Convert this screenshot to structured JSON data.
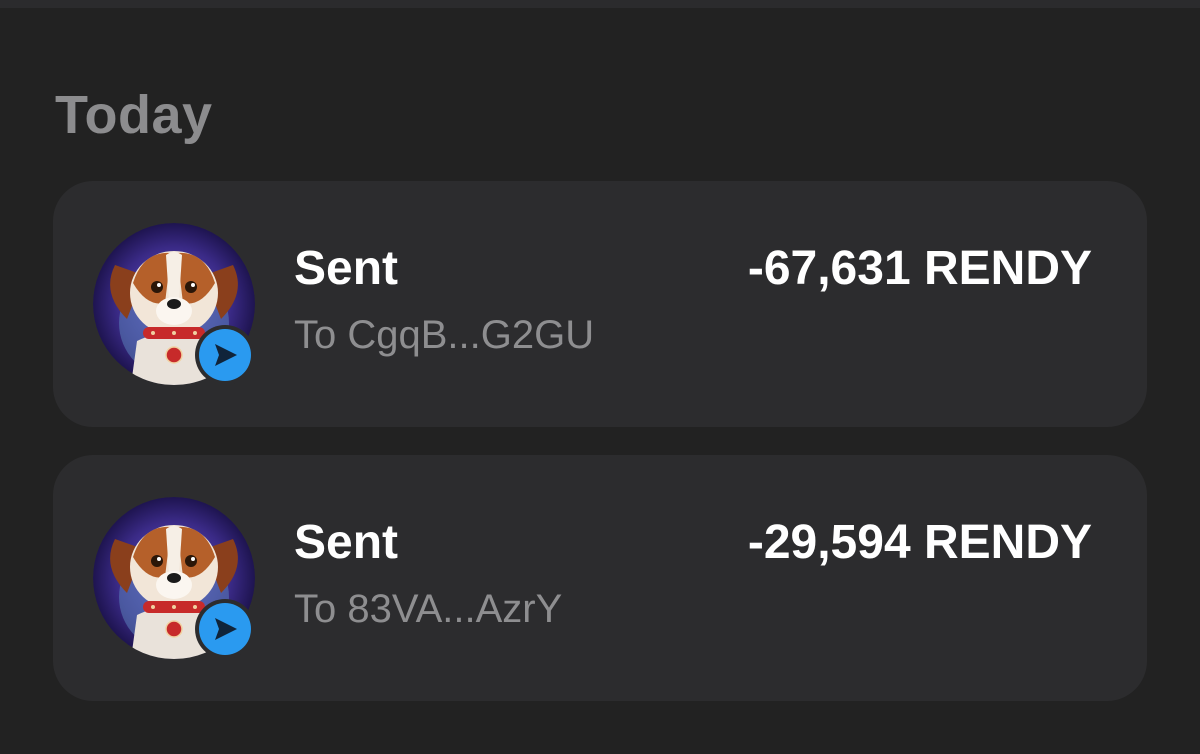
{
  "section": {
    "title": "Today"
  },
  "transactions": [
    {
      "type": "Sent",
      "destination": "To CgqB...G2GU",
      "amount": "-67,631 RENDY",
      "token_icon": "dog-avatar-icon",
      "status_icon": "send-arrow-icon"
    },
    {
      "type": "Sent",
      "destination": "To 83VA...AzrY",
      "amount": "-29,594 RENDY",
      "token_icon": "dog-avatar-icon",
      "status_icon": "send-arrow-icon"
    }
  ],
  "colors": {
    "background": "#222222",
    "card": "#2c2c2e",
    "section_title": "#8c8c8e",
    "primary_text": "#ffffff",
    "secondary_text": "#8e8e90",
    "send_badge": "#2a9af0"
  }
}
